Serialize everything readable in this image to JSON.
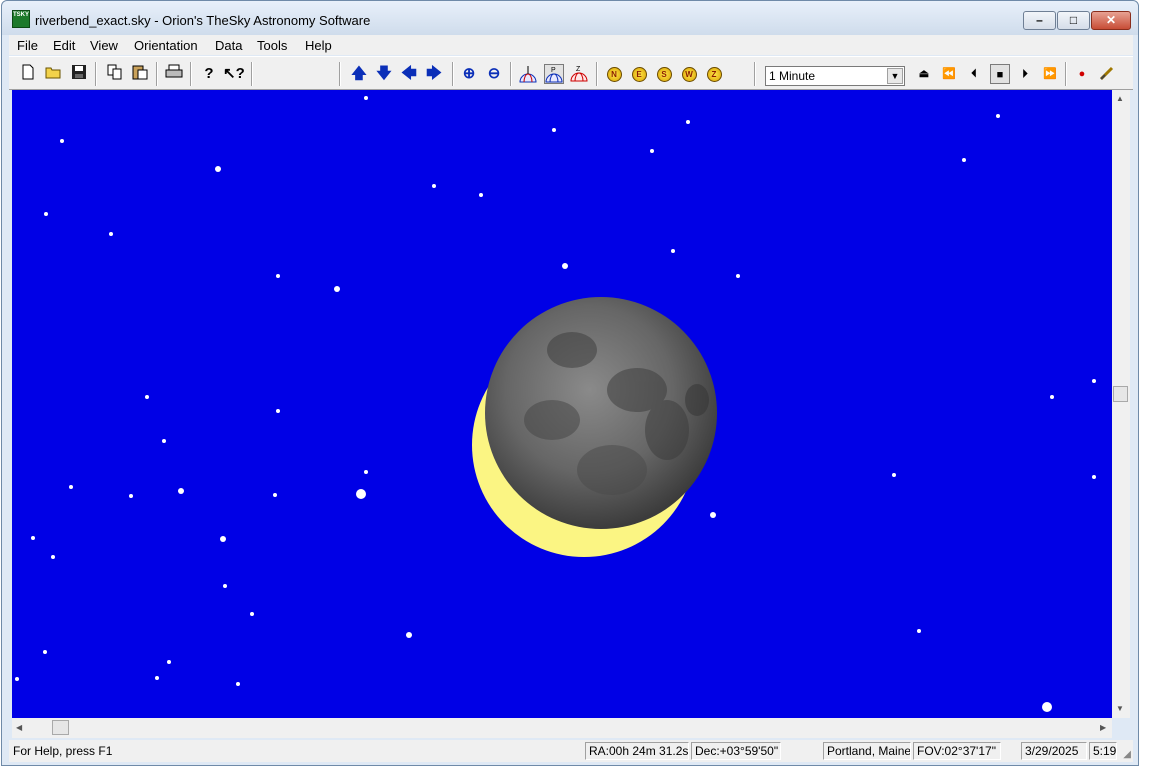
{
  "window": {
    "title": "riverbend_exact.sky - Orion's TheSky Astronomy Software",
    "app_icon_text": "TSKY"
  },
  "menu": [
    {
      "label": "File"
    },
    {
      "label": "Edit"
    },
    {
      "label": "View"
    },
    {
      "label": "Orientation"
    },
    {
      "label": "Data"
    },
    {
      "label": "Tools"
    },
    {
      "label": "Help"
    }
  ],
  "toolbar": {
    "icons": {
      "new": "new-document-icon",
      "open": "open-folder-icon",
      "save": "save-disk-icon",
      "copy": "copy-icon",
      "paste": "paste-icon",
      "print": "print-icon",
      "help": "help-icon",
      "context_help": "context-help-icon"
    },
    "nav_glyphs": {
      "up": "🡅",
      "down": "🡇",
      "left": "🡄",
      "right": "🡆"
    },
    "zoom_glyphs": {
      "in": "⊕",
      "out": "⊖"
    },
    "view_letters": {
      "view1": "",
      "view2": "P",
      "view3": "Z"
    },
    "planet_letters": [
      "N",
      "E",
      "S",
      "W",
      "Z"
    ],
    "time_step": "1 Minute",
    "media_glyphs": {
      "eject": "⏏",
      "rewind_fast": "⏪",
      "step_back": "⏴",
      "stop": "■",
      "step_forward": "⏵",
      "forward_fast": "⏩",
      "record": "●"
    }
  },
  "colors": {
    "sky": "#0000e6",
    "moon_dark": "#5c5c5c",
    "moon_lit": "#fbf583"
  },
  "status": {
    "help": "For Help, press F1",
    "ra": "RA:00h 24m 31.2s",
    "dec": "Dec:+03°59'50\"",
    "location": "Portland, Maine",
    "fov": "FOV:02°37'17\"",
    "date": "3/29/2025",
    "time": "5:19"
  }
}
